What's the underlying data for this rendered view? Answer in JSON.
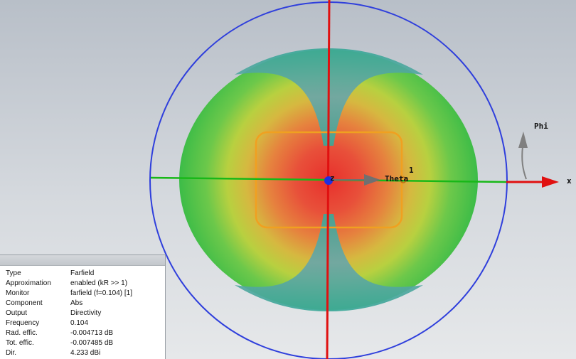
{
  "scene": {
    "axes": {
      "x_label": "x",
      "z_label": "z",
      "theta_label": "Theta",
      "phi_label": "Phi",
      "port_label": "1"
    },
    "colors": {
      "sphere_outline": "#2f3fdc",
      "z_axis": "#e01010",
      "y_axis": "#18b818",
      "x_axis": "#e01010",
      "antenna": "#f0a020",
      "origin_dot": "#2030e0",
      "theta_arrow": "#707070",
      "phi_arrow": "#808080"
    }
  },
  "info_panel": {
    "rows": [
      {
        "key": "Type",
        "value": "Farfield"
      },
      {
        "key": "Approximation",
        "value": "enabled (kR >> 1)"
      },
      {
        "key": "Monitor",
        "value": "farfield (f=0.104) [1]"
      },
      {
        "key": "Component",
        "value": "Abs"
      },
      {
        "key": "Output",
        "value": "Directivity"
      },
      {
        "key": "Frequency",
        "value": "0.104"
      },
      {
        "key": "Rad. effic.",
        "value": "-0.004713 dB"
      },
      {
        "key": "Tot. effic.",
        "value": "-0.007485 dB"
      },
      {
        "key": "Dir.",
        "value": "4.233 dBi"
      }
    ]
  }
}
